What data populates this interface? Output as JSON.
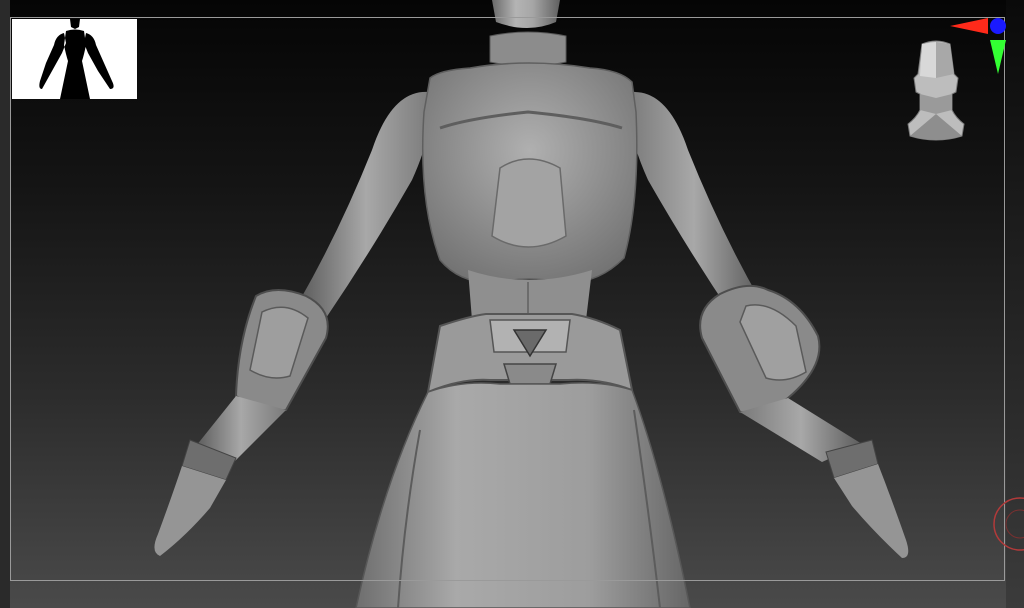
{
  "app": {
    "name": "",
    "view": "sculpt-viewport"
  },
  "viewport": {
    "background_top": "#050505",
    "background_bottom": "#4a4a4a",
    "frame_color": "#9a9a9a"
  },
  "model": {
    "material_color": "#9b9b9b",
    "highlight_color": "#c8c8c8",
    "shadow_color": "#5a5a5a"
  },
  "thumbnail": {
    "background": "#ffffff",
    "silhouette_color": "#000000"
  },
  "gizmo": {
    "x_axis_color": "#ff2a1a",
    "y_axis_color": "#33ff33",
    "z_axis_color": "#1a1aff"
  },
  "icons": {
    "navigation_head": "head-navigation-icon",
    "axis": "axis-gizmo-icon",
    "rotate": "rotate-ring-icon"
  }
}
